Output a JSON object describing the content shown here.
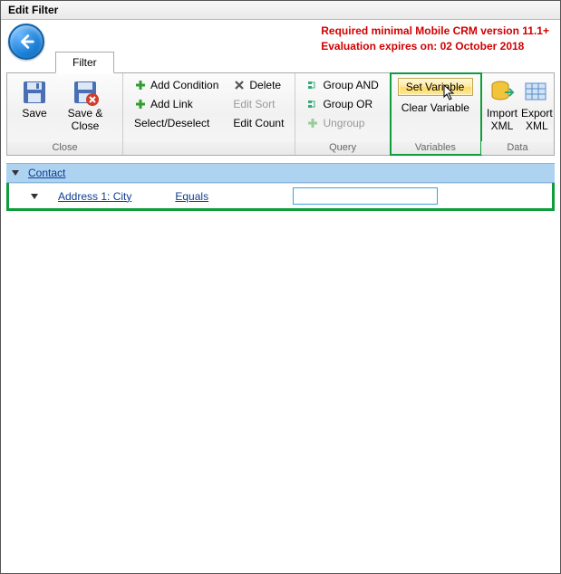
{
  "window_title": "Edit Filter",
  "notice_line1": "Required minimal Mobile CRM version 11.1+",
  "notice_line2": "Evaluation expires on: 02 October 2018",
  "tab_filter": "Filter",
  "ribbon": {
    "close": {
      "title": "Close",
      "save": "Save",
      "save_close": "Save & Close"
    },
    "group2": {
      "add_condition": "Add Condition",
      "add_link": "Add Link",
      "select_deselect": "Select/Deselect",
      "delete": "Delete",
      "edit_sort": "Edit Sort",
      "edit_count": "Edit Count"
    },
    "query": {
      "title": "Query",
      "group_and": "Group AND",
      "group_or": "Group OR",
      "ungroup": "Ungroup"
    },
    "variables": {
      "title": "Variables",
      "set_variable": "Set Variable",
      "clear_variable": "Clear Variable"
    },
    "data": {
      "title": "Data",
      "import_xml": "Import XML",
      "export_xml": "Export XML"
    }
  },
  "entity": {
    "name": "Contact"
  },
  "condition": {
    "field": "Address 1: City",
    "operator": "Equals",
    "value": ""
  }
}
